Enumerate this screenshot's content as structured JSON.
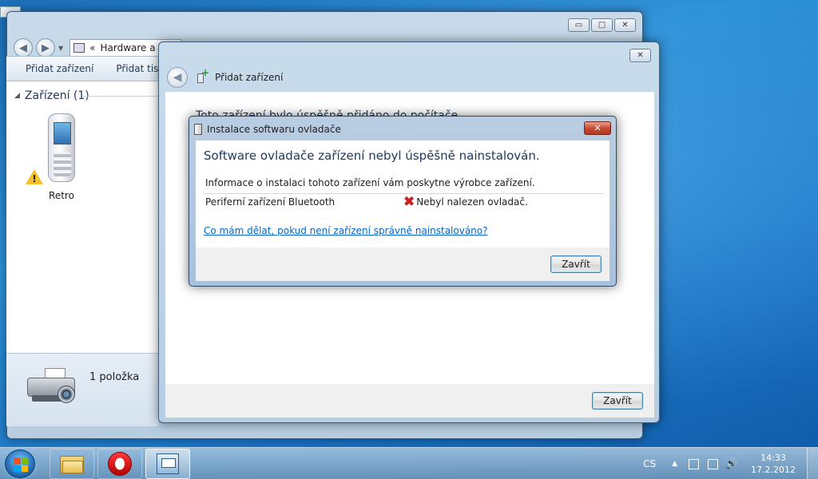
{
  "back_window": {
    "address_text": "Hardware a zv",
    "address_chevrons": "«",
    "toolbar": {
      "add_device": "Přidat zařízení",
      "add_printer": "Přidat tiskár"
    },
    "group_header": "Zařízení (1)",
    "device_name": "Retro",
    "details_count": "1 položka",
    "caption": {
      "minimize": "▭",
      "maximize": "□",
      "close": "✕"
    }
  },
  "mid_window": {
    "title": "Přidat zařízení",
    "heading": "Toto zařízení bylo úspěšně přidáno do počítače",
    "close_button": "Zavřít",
    "caption_close": "✕"
  },
  "dialog": {
    "title": "Instalace softwaru ovladače",
    "heading": "Software ovladače zařízení nebyl úspěšně nainstalován.",
    "info": "Informace o instalaci tohoto zařízení vám poskytne výrobce zařízení.",
    "device": "Periferní zařízení Bluetooth",
    "status": "Nebyl nalezen ovladač.",
    "status_icon": "✖",
    "help_link": "Co mám dělat, pokud není zařízení správně nainstalováno?",
    "close_button": "Zavřít",
    "caption_close": "✕"
  },
  "taskbar": {
    "language": "CS",
    "tray_arrow": "▲",
    "time": "14:33",
    "date": "17.2.2012",
    "volume_glyph": "🔊"
  },
  "colors": {
    "accent": "#1e395b",
    "link": "#0066cc",
    "error": "#cc1f1f",
    "warning": "#f2c12e"
  }
}
